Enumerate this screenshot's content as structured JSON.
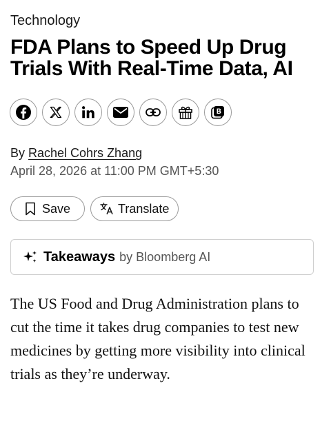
{
  "article": {
    "section": "Technology",
    "headline": "FDA Plans to Speed Up Drug Trials With Real-Time Data, AI",
    "byline_prefix": "By ",
    "author": "Rachel Cohrs Zhang",
    "date": "April 28, 2026 at 11:00 PM GMT+5:30",
    "body": "The US Food and Drug Administration plans to cut the time it takes drug companies to test new medicines by getting more visibility into clinical trials as they’re underway."
  },
  "share": {
    "icons": [
      "facebook-icon",
      "x-icon",
      "linkedin-icon",
      "mail-icon",
      "link-icon",
      "gift-icon",
      "bloomberg-icon"
    ]
  },
  "actions": {
    "save_label": "Save",
    "translate_label": "Translate"
  },
  "takeaways": {
    "title": "Takeaways",
    "by_label": "by Bloomberg AI"
  },
  "colors": {
    "text": "#000000",
    "muted": "#555555",
    "border": "#9a9a9a"
  }
}
